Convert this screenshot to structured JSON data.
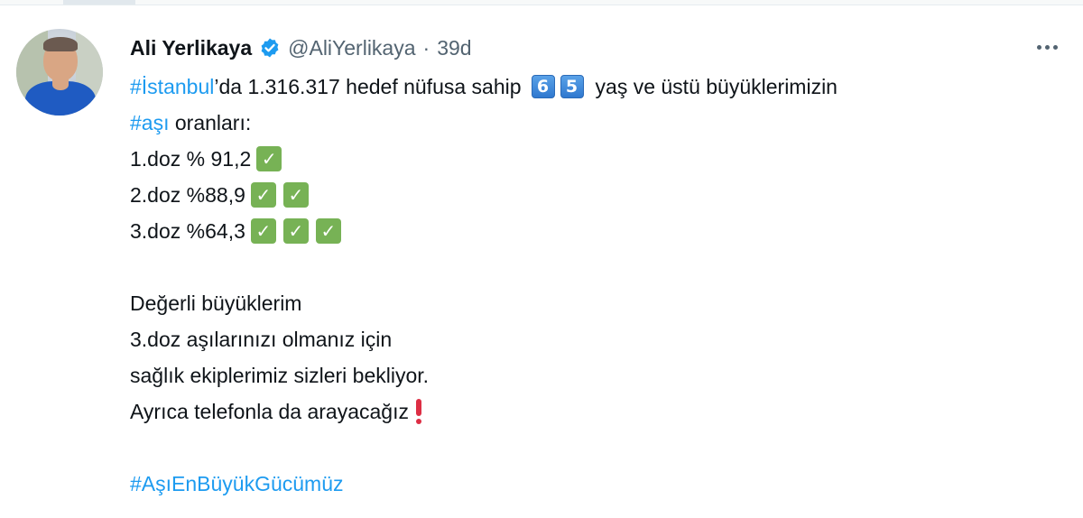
{
  "tweet": {
    "author": {
      "name": "Ali Yerlikaya",
      "handle": "@AliYerlikaya",
      "separator": "·",
      "time": "39d",
      "verified_color": "#1d9bf0"
    },
    "lines": {
      "l1_hashtag": "#İstanbul",
      "l1_text": "’da 1.316.317 hedef nüfusa sahip",
      "l1_keycap1": "6",
      "l1_keycap2": "5",
      "l1_text2": "yaş ve üstü büyüklerimizin",
      "l2_hashtag": "#aşı",
      "l2_text": " oranları:",
      "l3_text": "1.doz % 91,2",
      "l4_text": "2.doz %88,9",
      "l5_text": "3.doz %64,3",
      "l6_text": "Değerli büyüklerim",
      "l7_text": "3.doz aşılarınızı olmanız için",
      "l8_text": "sağlık ekiplerimiz sizleri bekliyor.",
      "l9_text": "Ayrıca telefonla da arayacağız",
      "l10_hashtag": "#AşıEnBüyükGücümüz"
    },
    "check_glyph": "✓",
    "colors": {
      "hashtag": "#1d9bf0",
      "check_box": "#77b255",
      "keycap": "#3b88e0",
      "exclamation": "#dd2e44"
    }
  }
}
